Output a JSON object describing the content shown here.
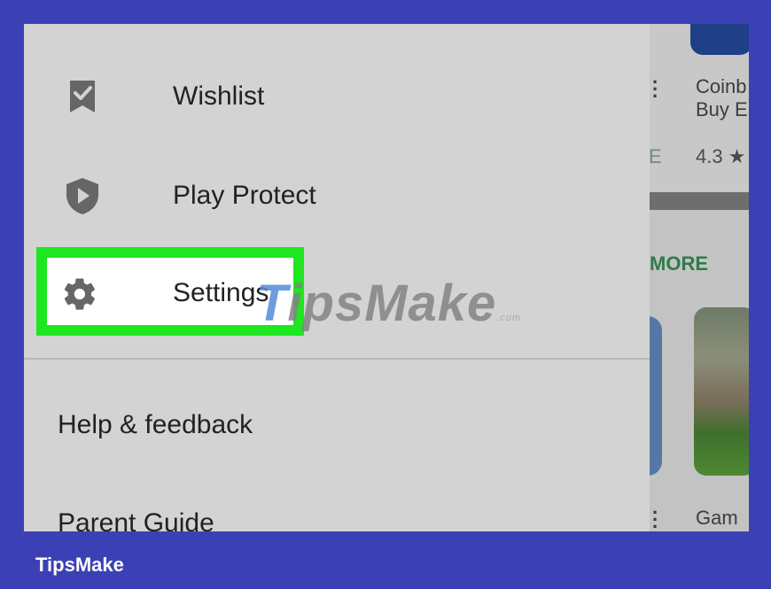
{
  "drawer": {
    "items": [
      {
        "label": "Wishlist",
        "icon": "bookmark-check-icon"
      },
      {
        "label": "Play Protect",
        "icon": "shield-play-icon"
      },
      {
        "label": "Settings",
        "icon": "gear-icon"
      }
    ],
    "help_label": "Help & feedback",
    "parent_label": "Parent Guide"
  },
  "background": {
    "app_title": "Coinb\nBuy E",
    "rating": "4.3 ★",
    "edge_letter": "E",
    "more_label": "MORE",
    "game_title": "Gam"
  },
  "watermark": {
    "text_t": "T",
    "text_rest": "ipsMake",
    "suffix": ".com"
  },
  "footer": {
    "brand": "TipsMake"
  },
  "colors": {
    "frame": "#3b41b5",
    "highlight": "#1ee620",
    "drawer": "#d3d3d3"
  }
}
